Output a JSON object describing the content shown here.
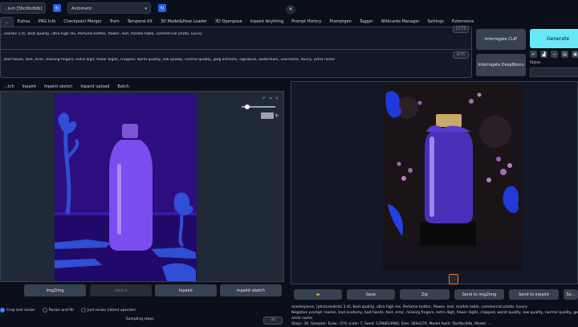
{
  "top": {
    "checkpoint": "...ium [5bc0bc8db]",
    "vae": "Automatic",
    "close_glyph": "✕"
  },
  "tabs": [
    "...",
    "Extras",
    "PNG Info",
    "Checkpoint Merger",
    "Train",
    "Temporal-Kit",
    "3D Model&Pose Loader",
    "3D Openpose",
    "Inpaint Anything",
    "Prompt History",
    "Promptgen",
    "Tagger",
    "Wildcards Manager",
    "Settings",
    "Extensions"
  ],
  "prompt": {
    "text": "...ealistic:1.4), best quality, ultra high res, Perfume bottler, flower, leaf, marble table, commercial photo, luxury",
    "counter": "27/75",
    "negative_text": "...bad hands, text, error, missing fingers, extra digit, fewer digits, cropped, worst quality, low quality, normal quality, jpeg artifacts, signature, watermark, username, blurry, artist name",
    "negative_counter": "8/75"
  },
  "right_controls": {
    "interrogate_clip": "Interrogate CLIP",
    "interrogate_deepbooru": "Interrogate DeepBooru",
    "generate": "Generate",
    "styles_label": "Styles"
  },
  "subtabs": [
    "...tch",
    "Inpaint",
    "Inpaint sketch",
    "Inpaint upload",
    "Batch"
  ],
  "left_buttons": [
    "img2img",
    "sketch",
    "inpaint",
    "inpaint sketch"
  ],
  "output_buttons": [
    "Save",
    "Zip",
    "Send to img2img",
    "Send to inpaint",
    "Se..."
  ],
  "output_info": {
    "line1": "masterpiece, (photorealistic:1.4), best quality, ultra high res, Perfume bottler, flower, leaf, marble table, commercial photo, luxury",
    "line2": "Negative prompt: lowres, bad anatomy, bad hands, text, error, missing fingers, extra digit, fewer digits, cropped, worst quality, low quality, normal quality, jpeg artifacts, signature, waterma...",
    "line3": "artist name",
    "line4": "Steps: 30, Sampler: Euler, CFG scale: 7, Seed: 1296813980, Size: 384x576, Model hash: 5bc0bc8db, Model: ..."
  },
  "resize": {
    "options": [
      "Crop and resize",
      "Resize and fill",
      "Just resize (latent upscale)"
    ],
    "selected": 0
  },
  "sampling": {
    "label": "Sampling steps",
    "value": "30"
  },
  "colors": {
    "accent": "#2563eb",
    "generate": "#67e8f9",
    "background": "#0b0f19",
    "canvas": "#2c0e7e"
  }
}
